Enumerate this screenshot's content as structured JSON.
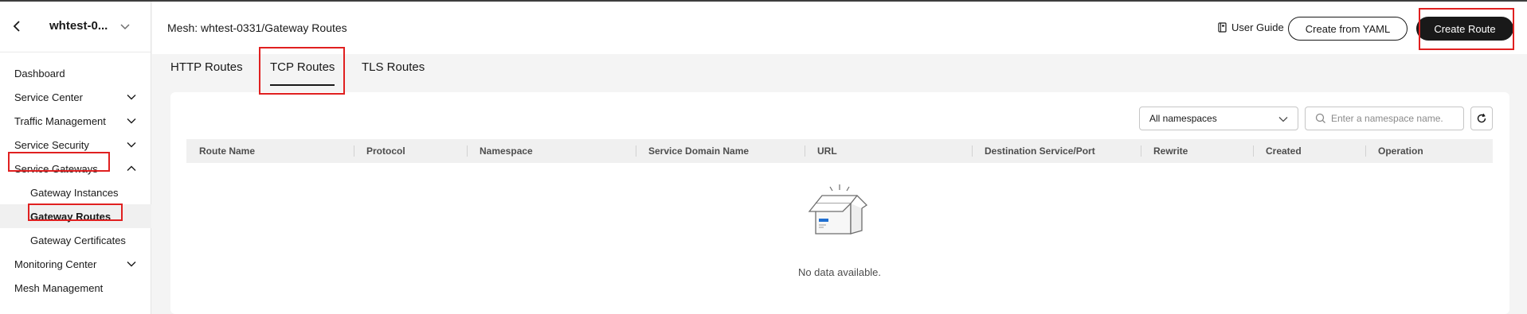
{
  "sidebar": {
    "mesh_name": "whtest-0...",
    "items": [
      {
        "label": "Dashboard"
      },
      {
        "label": "Service Center"
      },
      {
        "label": "Traffic Management"
      },
      {
        "label": "Service Security"
      },
      {
        "label": "Service Gateways"
      },
      {
        "label": "Gateway Instances"
      },
      {
        "label": "Gateway Routes"
      },
      {
        "label": "Gateway Certificates"
      },
      {
        "label": "Monitoring Center"
      },
      {
        "label": "Mesh Management"
      }
    ]
  },
  "header": {
    "breadcrumb": "Mesh: whtest-0331/Gateway Routes",
    "user_guide": "User Guide",
    "create_from_yaml": "Create from YAML",
    "create_route": "Create Route"
  },
  "tabs": [
    {
      "label": "HTTP Routes",
      "active": false
    },
    {
      "label": "TCP Routes",
      "active": true
    },
    {
      "label": "TLS Routes",
      "active": false
    }
  ],
  "filters": {
    "namespace_select": "All namespaces",
    "search_placeholder": "Enter a namespace name."
  },
  "table": {
    "columns": [
      "Route Name",
      "Protocol",
      "Namespace",
      "Service Domain Name",
      "URL",
      "Destination Service/Port",
      "Rewrite",
      "Created",
      "Operation"
    ],
    "rows": [],
    "empty_text": "No data available."
  },
  "colors": {
    "primary_button": "#191919",
    "highlight_annotation": "#e02020",
    "empty_icon_accent": "#1f6fd1"
  }
}
